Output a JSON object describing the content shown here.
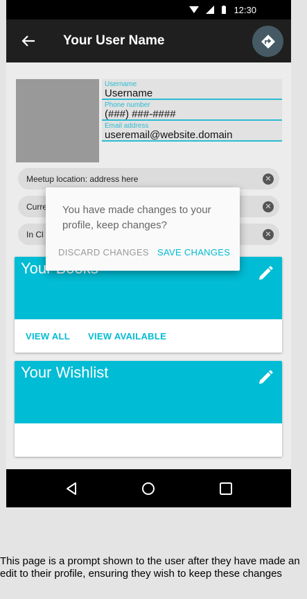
{
  "status_bar": {
    "time": "12:30"
  },
  "app_bar": {
    "title": "Your User Name"
  },
  "profile": {
    "username": {
      "label": "Username",
      "value": "Username"
    },
    "phone": {
      "label": "Phone number",
      "value": "(###) ###-####"
    },
    "email": {
      "label": "Email address",
      "value": "useremail@website.domain"
    }
  },
  "chips": [
    {
      "label": "Meetup location: address here"
    },
    {
      "label": "Curre"
    },
    {
      "label": "In Cl"
    }
  ],
  "cards": {
    "books": {
      "title": "Your Books",
      "actions": [
        "VIEW ALL",
        "VIEW AVAILABLE"
      ]
    },
    "wishlist": {
      "title": "Your Wishlist"
    }
  },
  "dialog": {
    "message": "You have made changes to your profile, keep changes?",
    "discard_label": "DISCARD CHANGES",
    "save_label": "SAVE CHANGES"
  },
  "caption": "This page is a prompt shown to the user after they have made an edit to their profile, ensuring they wish to keep these changes",
  "colors": {
    "accent": "#00bcd4",
    "app_bar": "#1f1f1f",
    "fab": "#455a64"
  },
  "icons": {
    "back": "arrow-left-icon",
    "directions": "directions-icon",
    "edit": "pencil-icon",
    "chip_close": "close-circle-icon",
    "nav_back": "triangle-back-icon",
    "nav_home": "circle-home-icon",
    "nav_recents": "square-recents-icon"
  }
}
